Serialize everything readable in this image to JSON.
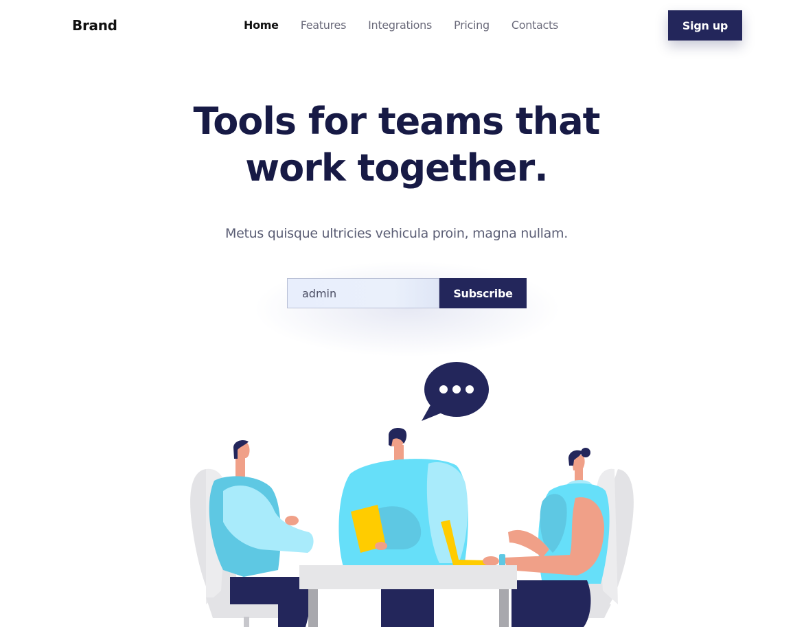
{
  "nav": {
    "brand": "Brand",
    "links": [
      "Home",
      "Features",
      "Integrations",
      "Pricing",
      "Contacts"
    ],
    "active": "Home",
    "signup_label": "Sign up"
  },
  "hero": {
    "title_line1": "Tools for teams that",
    "title_line2_prefix": "work ",
    "title_line2_highlight": "together",
    "title_line2_suffix": ".",
    "subtitle": "Metus quisque ultricies vehicula proin, magna nullam."
  },
  "subscribe": {
    "input_value": "admin",
    "button_label": "Subscribe"
  },
  "colors": {
    "primary": "#23265b",
    "accent": "#ffcc00",
    "title": "#171a45"
  },
  "illustration": {
    "icons": [
      "speech-bubble-icon",
      "team-meeting-illustration"
    ]
  }
}
